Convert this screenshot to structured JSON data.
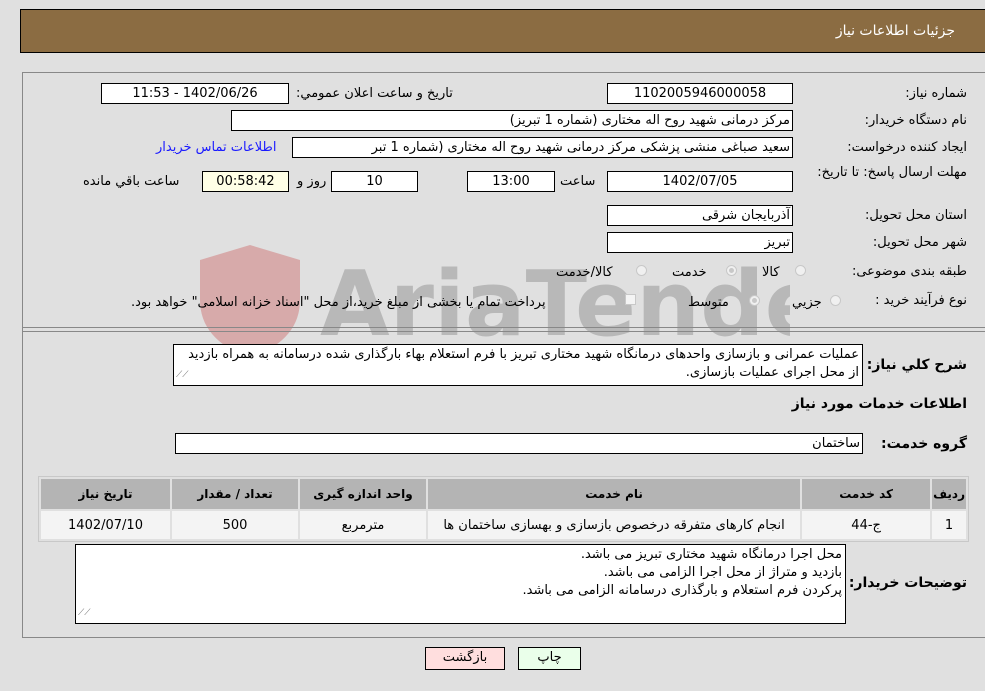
{
  "header": {
    "title": "جزئیات اطلاعات نیاز"
  },
  "fields": {
    "need_number_label": "شماره نیاز:",
    "need_number": "1102005946000058",
    "announce_label": "تاریخ و ساعت اعلان عمومي:",
    "announce_value": "1402/06/26 - 11:53",
    "buyer_org_label": "نام دستگاه خریدار:",
    "buyer_org": "مرکز درمانی شهید روح اله مختاری (شماره 1 تبریز)",
    "creator_label": "ایجاد کننده درخواست:",
    "creator": "سعید صباغی منشی  پزشکی مرکز درمانی شهید روح اله مختاری (شماره 1 تبر",
    "contact_link": "اطلاعات تماس خریدار",
    "deadline_label": "مهلت ارسال پاسخ: تا تاریخ:",
    "deadline_date": "1402/07/05",
    "time_label": "ساعت",
    "deadline_time": "13:00",
    "days_value": "10",
    "days_label": "روز و",
    "remaining_time": "00:58:42",
    "remaining_label": "ساعت باقي مانده",
    "province_label": "استان محل تحویل:",
    "province": "آذربایجان شرقی",
    "city_label": "شهر محل تحویل:",
    "city": "تبریز",
    "category_label": "طبقه بندی موضوعی:",
    "category_options": [
      {
        "label": "کالا",
        "selected": false
      },
      {
        "label": "خدمت",
        "selected": true
      },
      {
        "label": "کالا/خدمت",
        "selected": false
      }
    ],
    "process_label": "نوع فرآیند خرید :",
    "process_options": [
      {
        "label": "جزيي",
        "selected": false
      },
      {
        "label": "متوسط",
        "selected": true
      }
    ],
    "treasury_note": "پرداخت تمام یا بخشی از مبلغ خرید،از محل \"اسناد خزانه اسلامی\" خواهد بود.",
    "treasury_checked": false
  },
  "description": {
    "label": "شرح کلي نياز:",
    "text": "عملیات عمرانی و بازسازی واحدهای درمانگاه شهید مختاری تبریز با فرم استعلام بهاء بارگذاری شده درسامانه به همراه بازدید از محل اجرای عملیات بازسازی."
  },
  "services": {
    "section_title": "اطلاعات خدمات مورد نیاز",
    "group_label": "گروه خدمت:",
    "group_value": "ساختمان",
    "columns": [
      "ردیف",
      "کد خدمت",
      "نام خدمت",
      "واحد اندازه گیری",
      "تعداد / مقدار",
      "تاریخ نیاز"
    ],
    "rows": [
      {
        "row": "1",
        "code": "ج-44",
        "name": "انجام کارهای متفرقه درخصوص بازسازی و بهسازی ساختمان ها",
        "unit": "مترمربع",
        "qty": "500",
        "date": "1402/07/10"
      }
    ]
  },
  "buyer_notes": {
    "label": "توضیحات خریدار:",
    "lines": [
      "محل اجرا درمانگاه شهید مختاری تبریز می باشد.",
      "بازدید و متراژ از محل اجرا الزامی می باشد.",
      "پرکردن فرم استعلام و بارگذاری درسامانه الزامی می باشد."
    ]
  },
  "buttons": {
    "print": "چاپ",
    "back": "بازگشت"
  },
  "colors": {
    "header": "#8b6c42",
    "print_bg": "#eaffea",
    "back_bg": "#ffdede",
    "link": "#1a1aff"
  },
  "watermark": "AriaTender.neT"
}
